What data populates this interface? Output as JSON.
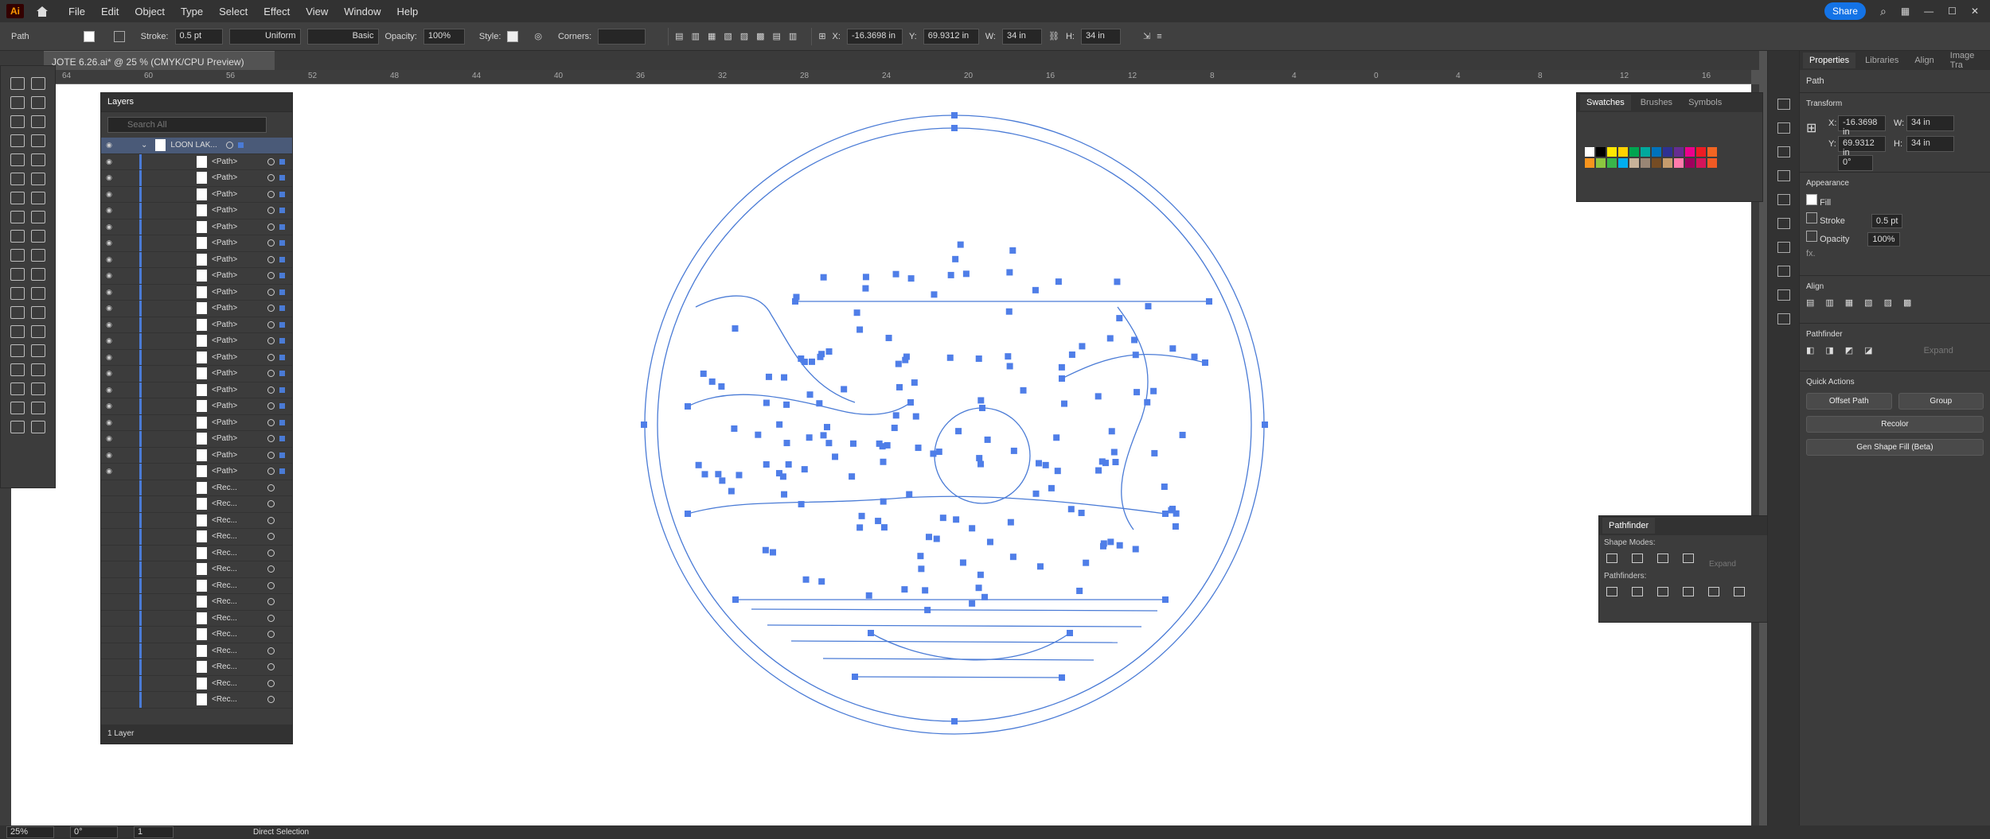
{
  "app": {
    "logo": "Ai",
    "menus": [
      "File",
      "Edit",
      "Object",
      "Type",
      "Select",
      "Effect",
      "View",
      "Window",
      "Help"
    ],
    "share": "Share"
  },
  "control": {
    "object": "Path",
    "stroke_label": "Stroke:",
    "stroke_val": "0.5 pt",
    "profile": "Uniform",
    "brush": "Basic",
    "opacity_label": "Opacity:",
    "opacity_val": "100%",
    "style_label": "Style:",
    "corners_label": "Corners:",
    "x_label": "X:",
    "x_val": "-16.3698 in",
    "y_label": "Y:",
    "y_val": "69.9312 in",
    "w_label": "W:",
    "w_val": "34 in",
    "h_label": "H:",
    "h_val": "34 in"
  },
  "doc_tab": "JOTE 6.26.ai* @ 25 % (CMYK/CPU Preview)",
  "ruler": [
    "64",
    "60",
    "56",
    "52",
    "48",
    "44",
    "40",
    "36",
    "32",
    "28",
    "24",
    "20",
    "16",
    "12",
    "8",
    "4",
    "0",
    "4",
    "8",
    "12",
    "16"
  ],
  "layers": {
    "title": "Layers",
    "search_placeholder": "Search All",
    "top": "LOON LAK...",
    "rows": [
      "<Path>",
      "<Path>",
      "<Path>",
      "<Path>",
      "<Path>",
      "<Path>",
      "<Path>",
      "<Path>",
      "<Path>",
      "<Path>",
      "<Path>",
      "<Path>",
      "<Path>",
      "<Path>",
      "<Path>",
      "<Path>",
      "<Path>",
      "<Path>",
      "<Path>",
      "<Path>",
      "<Rec...",
      "<Rec...",
      "<Rec...",
      "<Rec...",
      "<Rec...",
      "<Rec...",
      "<Rec...",
      "<Rec...",
      "<Rec...",
      "<Rec...",
      "<Rec...",
      "<Rec...",
      "<Rec...",
      "<Rec..."
    ],
    "footer": "1 Layer"
  },
  "swatches": {
    "tabs": [
      "Swatches",
      "Brushes",
      "Symbols"
    ]
  },
  "pathfinder": {
    "title": "Pathfinder",
    "shape_modes": "Shape Modes:",
    "pathfinders": "Pathfinders:",
    "expand": "Expand"
  },
  "props": {
    "tabs": [
      "Properties",
      "Libraries",
      "Align",
      "Image Tra"
    ],
    "kind": "Path",
    "transform": "Transform",
    "x_label": "X:",
    "x": "-16.3698 in",
    "y_label": "Y:",
    "y": "69.9312 in",
    "w_label": "W:",
    "w": "34 in",
    "h_label": "H:",
    "h": "34 in",
    "angle": "0°",
    "appearance": "Appearance",
    "fill": "Fill",
    "stroke": "Stroke",
    "stroke_val": "0.5 pt",
    "opacity": "Opacity",
    "opacity_val": "100%",
    "fx": "fx.",
    "align": "Align",
    "pathfinder": "Pathfinder",
    "expand": "Expand",
    "quick": "Quick Actions",
    "offset": "Offset Path",
    "group": "Group",
    "recolor": "Recolor",
    "gen": "Gen Shape Fill (Beta)"
  },
  "status": {
    "zoom": "25%",
    "angle": "0°",
    "artboard": "1",
    "tool": "Direct Selection"
  },
  "colors": {
    "accent": "#1473e6",
    "path": "#4a7bd6",
    "anchor": "#4f7ee8"
  }
}
